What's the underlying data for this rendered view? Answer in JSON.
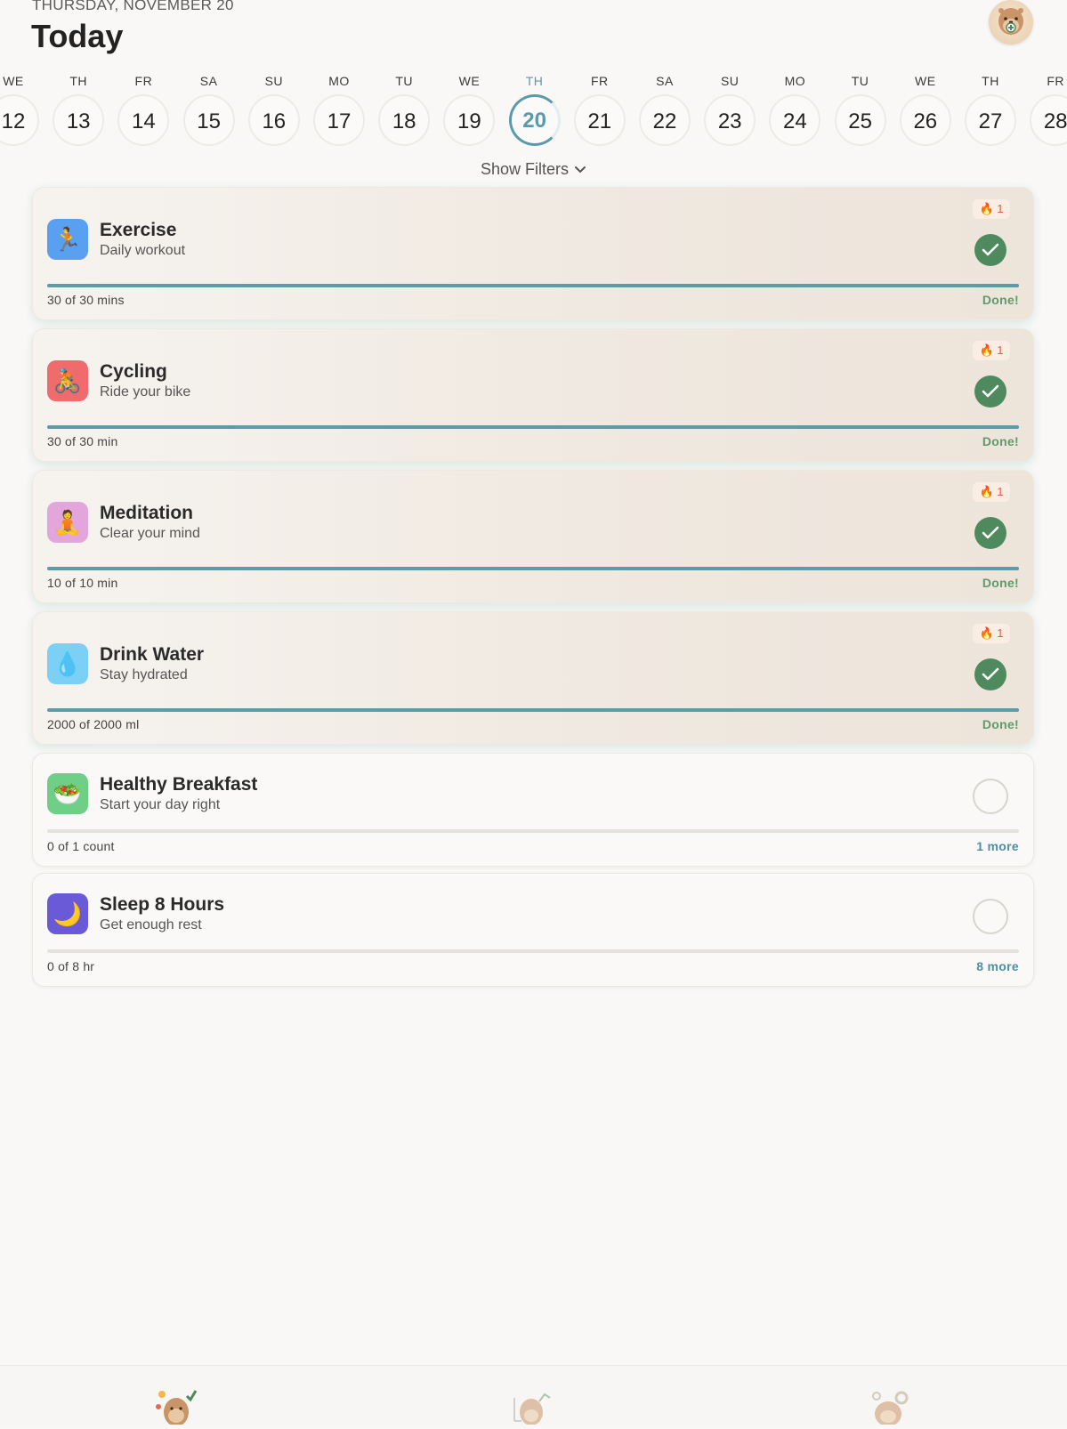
{
  "header": {
    "date": "THURSDAY, NOVEMBER 20",
    "title": "Today"
  },
  "week": [
    {
      "abbr": "WE",
      "num": "12"
    },
    {
      "abbr": "TH",
      "num": "13"
    },
    {
      "abbr": "FR",
      "num": "14"
    },
    {
      "abbr": "SA",
      "num": "15"
    },
    {
      "abbr": "SU",
      "num": "16"
    },
    {
      "abbr": "MO",
      "num": "17"
    },
    {
      "abbr": "TU",
      "num": "18"
    },
    {
      "abbr": "WE",
      "num": "19"
    },
    {
      "abbr": "TH",
      "num": "20",
      "selected": true
    },
    {
      "abbr": "FR",
      "num": "21"
    },
    {
      "abbr": "SA",
      "num": "22"
    },
    {
      "abbr": "SU",
      "num": "23"
    },
    {
      "abbr": "MO",
      "num": "24"
    },
    {
      "abbr": "TU",
      "num": "25"
    },
    {
      "abbr": "WE",
      "num": "26"
    },
    {
      "abbr": "TH",
      "num": "27"
    },
    {
      "abbr": "FR",
      "num": "28"
    }
  ],
  "filters_label": "Show Filters",
  "habits": [
    {
      "name": "Exercise",
      "subtitle": "Daily workout",
      "icon": "running-person-icon",
      "emoji": "🏃",
      "icon_bg": "#5aa0f0",
      "streak": "1",
      "progress_text": "30 of 30 mins",
      "status": "Done!",
      "progress": 1.0,
      "done": true
    },
    {
      "name": "Cycling",
      "subtitle": "Ride your bike",
      "icon": "bicycle-icon",
      "emoji": "🚴",
      "icon_bg": "#f06b6b",
      "streak": "1",
      "progress_text": "30 of 30 min",
      "status": "Done!",
      "progress": 1.0,
      "done": true
    },
    {
      "name": "Meditation",
      "subtitle": "Clear your mind",
      "icon": "meditation-icon",
      "emoji": "🧘",
      "icon_bg": "#e3a6dc",
      "streak": "1",
      "progress_text": "10 of 10 min",
      "status": "Done!",
      "progress": 1.0,
      "done": true
    },
    {
      "name": "Drink Water",
      "subtitle": "Stay hydrated",
      "icon": "water-drop-icon",
      "emoji": "💧",
      "icon_bg": "#7cd0f5",
      "streak": "1",
      "progress_text": "2000 of 2000 ml",
      "status": "Done!",
      "progress": 1.0,
      "done": true
    },
    {
      "name": "Healthy Breakfast",
      "subtitle": "Start your day right",
      "icon": "salad-icon",
      "emoji": "🥗",
      "icon_bg": "#6fcf86",
      "progress_text": "0 of 1 count",
      "status": "1 more",
      "progress": 0.0,
      "done": false
    },
    {
      "name": "Sleep 8 Hours",
      "subtitle": "Get enough rest",
      "icon": "moon-icon",
      "emoji": "🌙",
      "icon_bg": "#6a5ad8",
      "progress_text": "0 of 8 hr",
      "status": "8 more",
      "progress": 0.0,
      "done": false
    }
  ],
  "colors": {
    "accent": "#5b9aac",
    "done_green": "#4f8a5e",
    "done_text": "#5e9a6a",
    "more_text": "#4d8fa3",
    "streak_text": "#e25c3c"
  },
  "tabs": [
    {
      "icon": "otter-check-icon"
    },
    {
      "icon": "otter-chart-icon"
    },
    {
      "icon": "otter-settings-icon"
    }
  ]
}
